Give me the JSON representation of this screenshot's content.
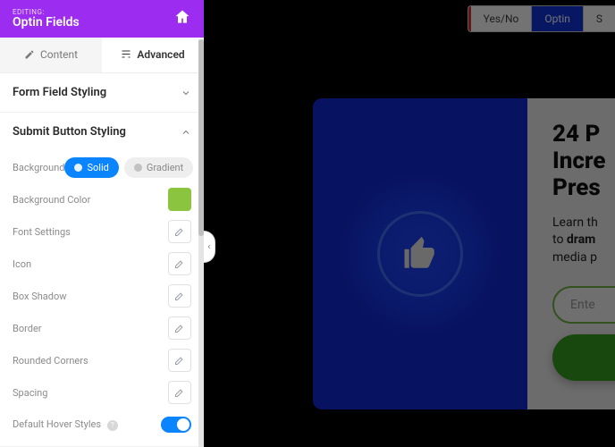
{
  "header": {
    "editing_label": "EDITING:",
    "title": "Optin Fields"
  },
  "tabs": {
    "content": "Content",
    "advanced": "Advanced",
    "active": "advanced"
  },
  "sections": {
    "form_field_styling": {
      "label": "Form Field Styling",
      "expanded": false
    },
    "submit_button_styling": {
      "label": "Submit Button Styling",
      "expanded": true,
      "rows": {
        "background": {
          "label": "Background",
          "options": {
            "solid": "Solid",
            "gradient": "Gradient"
          },
          "value": "solid"
        },
        "background_color": {
          "label": "Background Color",
          "value": "#8bc53f"
        },
        "font_settings": {
          "label": "Font Settings"
        },
        "icon": {
          "label": "Icon"
        },
        "box_shadow": {
          "label": "Box Shadow"
        },
        "border": {
          "label": "Border"
        },
        "rounded_corners": {
          "label": "Rounded Corners"
        },
        "spacing": {
          "label": "Spacing"
        },
        "default_hover_styles": {
          "label": "Default Hover Styles",
          "value": true
        }
      }
    }
  },
  "topbar": {
    "yesno": "Yes/No",
    "optin": "Optin",
    "s": "S",
    "active": "optin"
  },
  "preview": {
    "title_line1": "24 P",
    "title_line2": "Incre",
    "title_line3": "Pres",
    "body_prefix": "Learn th",
    "body_mid_prefix": "to ",
    "body_bold": "dram",
    "body_suffix": "media p",
    "input_placeholder": "Ente"
  }
}
